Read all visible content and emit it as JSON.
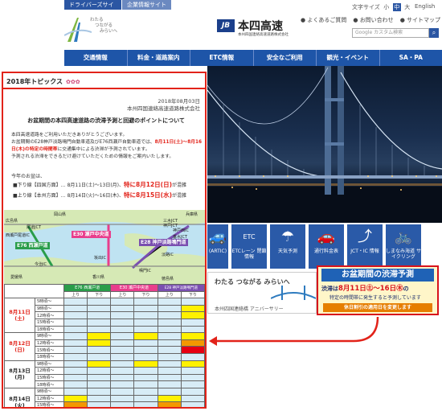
{
  "top_tabs": [
    "ドライバーズサイト",
    "企業情報サイト"
  ],
  "header": {
    "logo_text_1": "わたる",
    "logo_text_2": "つながる",
    "logo_text_3": "みらいへ",
    "brand_mark": "JB",
    "brand_name": "本四高速",
    "brand_sub": "本州四国連絡高速道路株式会社",
    "text_size_label": "文字サイズ",
    "text_size_options": [
      "小",
      "中",
      "大"
    ],
    "text_size_selected": "中",
    "english": "English",
    "links": [
      "よくあるご質問",
      "お問い合わせ",
      "サイトマップ"
    ],
    "search_placeholder": "Google カスタム検索"
  },
  "nav": [
    "交通情報",
    "料金・道路案内",
    "ETC情報",
    "安全なご利用",
    "観光・イベント",
    "SA・PA"
  ],
  "icons": [
    {
      "label": "(ARTIC)",
      "glyph": "🚙"
    },
    {
      "label": "ETCレーン 閉鎖情報",
      "glyph": "ETC"
    },
    {
      "label": "天気予測",
      "glyph": "☂"
    },
    {
      "label": "通行料金表",
      "glyph": "🚗"
    },
    {
      "label": "JCT・IC 情報",
      "glyph": "⤴"
    },
    {
      "label": "しまなみ海道 サイクリング",
      "glyph": "🚲"
    }
  ],
  "banner_wataru": {
    "line1": "わたる つながる みらいへ",
    "line2": "本州四国連絡橋 アニバーサリー"
  },
  "banner_jam": {
    "title": "お盆期間の渋滞予測",
    "line1_a": "渋滞は",
    "line1_dates": "8月11日㊏～16日㊍",
    "line1_b": "の",
    "line2": "特定の時間帯に発生すると予測しています",
    "line3": "休日割引の適用日を変更します"
  },
  "panel": {
    "heading": "2018年トピックス",
    "date": "2018年08月03日",
    "org": "本州四国連絡高速道路株式会社",
    "title": "お盆期間の本四高速道路の渋滞予測と回避のポイントについて",
    "body_1": "本四高速道路をご利用いただきありがとうございます。",
    "body_2": "お盆期間のE28神戸淡路鳴門自動車道及びE76西瀬戸自動車道では、",
    "body_red_1": "8月11日(土)～8月16日(木)の特定の時間帯",
    "body_3": "に交通集中による渋滞が予測されています。",
    "body_4": "予測される渋滞をできるだけ避けていただくための情報をご案内いたします。",
    "question": "今年のお盆は、",
    "down_line": "■下り線【四国方面】… 8月11日(土)～13日(月)、",
    "down_red": "特に8月12日(日)",
    "down_tail": "が混雑",
    "up_line": "■上り線【本州方面】… 8月14日(火)～16日(木)、",
    "up_red": "特に8月15日(水)",
    "up_tail": "が混雑"
  },
  "map": {
    "labels": [
      "岡山県",
      "広島県",
      "愛媛県",
      "香川県",
      "徳島県",
      "兵庫県",
      "三木JCT",
      "西瀬戸尾道IC",
      "尾道JCT",
      "今治IC",
      "坂出IC",
      "鳴門IC",
      "神戸西IC",
      "淡路IC",
      "垂水JCT",
      "神戸JCT"
    ],
    "roads": [
      "E30 瀬戸中央道",
      "E76 西瀬戸道",
      "E28 神戸淡路鳴門道"
    ]
  },
  "jam_table": {
    "routes": [
      "E76 西瀬戸道",
      "E30 瀬戸中央道",
      "E28 神戸淡路鳴門道"
    ],
    "directions": [
      "上り",
      "下り",
      "上り",
      "下り",
      "上り",
      "下り"
    ],
    "days": [
      {
        "label": "8月11日",
        "wd": "(土)",
        "color": "red"
      },
      {
        "label": "8月12日",
        "wd": "(日)",
        "color": "red"
      },
      {
        "label": "8月13日",
        "wd": "(月)",
        "color": "black"
      },
      {
        "label": "8月14日",
        "wd": "(火)",
        "color": "black"
      }
    ],
    "times": [
      "5時頃～",
      "9時頃～",
      "12時頃～",
      "15時頃～",
      "18時頃～"
    ]
  }
}
